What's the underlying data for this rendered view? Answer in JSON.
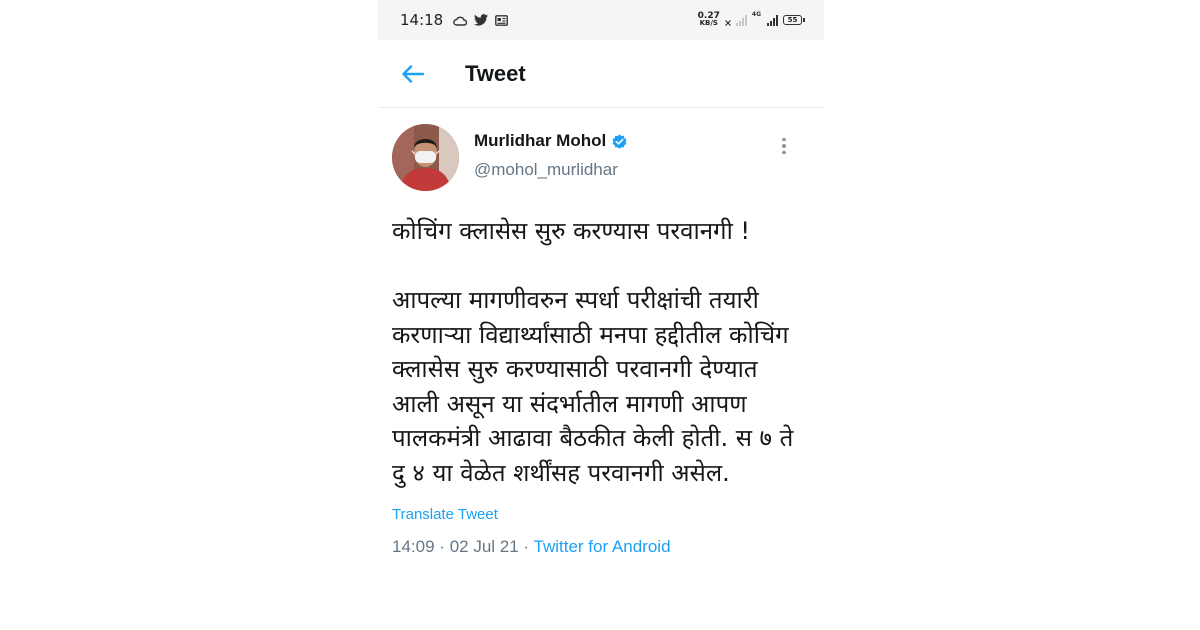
{
  "status_bar": {
    "time": "14:18",
    "icons_left": [
      "cloud-icon",
      "twitter-bird-icon",
      "news-card-icon"
    ],
    "net_speed_value": "0.27",
    "net_speed_unit": "KB/S",
    "signal_label": "4G",
    "battery_level": "55"
  },
  "header": {
    "back_icon": "arrow-left-icon",
    "title": "Tweet"
  },
  "tweet": {
    "author_name": "Murlidhar Mohol",
    "verified": true,
    "handle": "@mohol_murlidhar",
    "text": "कोचिंग क्लासेस सुरु करण्यास परवानगी !\n\nआपल्या मागणीवरुन स्पर्धा परीक्षांची तयारी करणाऱ्या विद्यार्थ्यांसाठी मनपा हद्दीतील कोचिंग क्लासेस सुरु करण्यासाठी परवानगी देण्यात आली असून या संदर्भातील मागणी आपण पालकमंत्री आढावा बैठकीत केली होती. स ७ ते दु ४ या वेळेत शर्थींसह परवानगी असेल.",
    "translate_label": "Translate Tweet",
    "time": "14:09",
    "date": "02 Jul 21",
    "separator": "·",
    "source": "Twitter for Android"
  },
  "colors": {
    "accent": "#1da1f2",
    "text_primary": "#14171a",
    "text_secondary": "#657786"
  }
}
